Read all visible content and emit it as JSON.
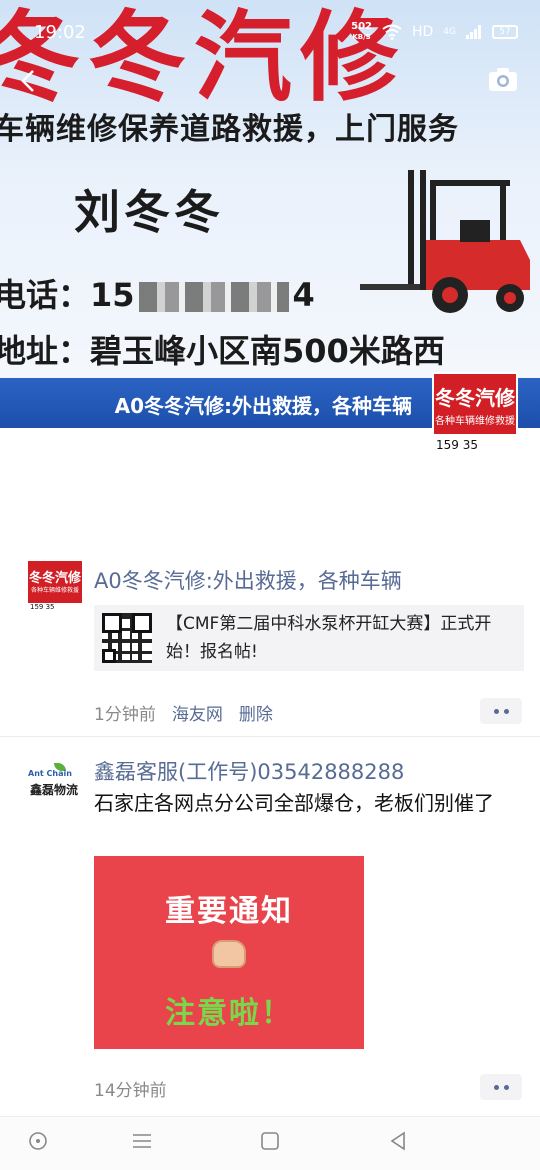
{
  "status_bar": {
    "time": "19:02",
    "speed_value": "502",
    "speed_unit": "KB/S",
    "network": "HD",
    "signal": "4G",
    "battery": "57"
  },
  "cover": {
    "headline": "冬冬汽修",
    "service_line": "车辆维修保养道路救援，上门服务",
    "person_name": "刘冬冬",
    "phone_label": "电话：",
    "phone_prefix": "15",
    "phone_suffix": "4",
    "address_label": "地址：",
    "address_value": "碧玉峰小区南500米路西",
    "signature": "A0冬冬汽修:外出救援，各种车辆"
  },
  "cover_avatar": {
    "title": "冬冬汽修",
    "subtitle": "各种车辆维修救援",
    "phone": "159 35"
  },
  "posts": [
    {
      "nickname": "A0冬冬汽修:外出救援，各种车辆",
      "avatar": {
        "title": "冬冬汽修",
        "subtitle": "各种车辆维修救援",
        "phone": "159 35"
      },
      "link_text": "【CMF第二届中科水泵杯开缸大赛】正式开始！报名帖!",
      "time": "1分钟前",
      "source": "海友网",
      "delete_label": "删除"
    },
    {
      "nickname": "鑫磊客服(工作号)03542888288",
      "avatar": {
        "brand_en": "Ant Chain",
        "brand_cn": "鑫磊物流"
      },
      "content": "石家庄各网点分公司全部爆仓，老板们别催了",
      "image": {
        "line1": "重要通知",
        "line2": "注意啦！"
      },
      "time": "14分钟前"
    }
  ],
  "icons": {
    "back": "back-arrow-icon",
    "camera": "camera-icon",
    "more": "more-dots-icon"
  },
  "colors": {
    "brand_red": "#d61f2c",
    "link_blue": "#576b95",
    "banner_blue": "#1d4fab"
  }
}
